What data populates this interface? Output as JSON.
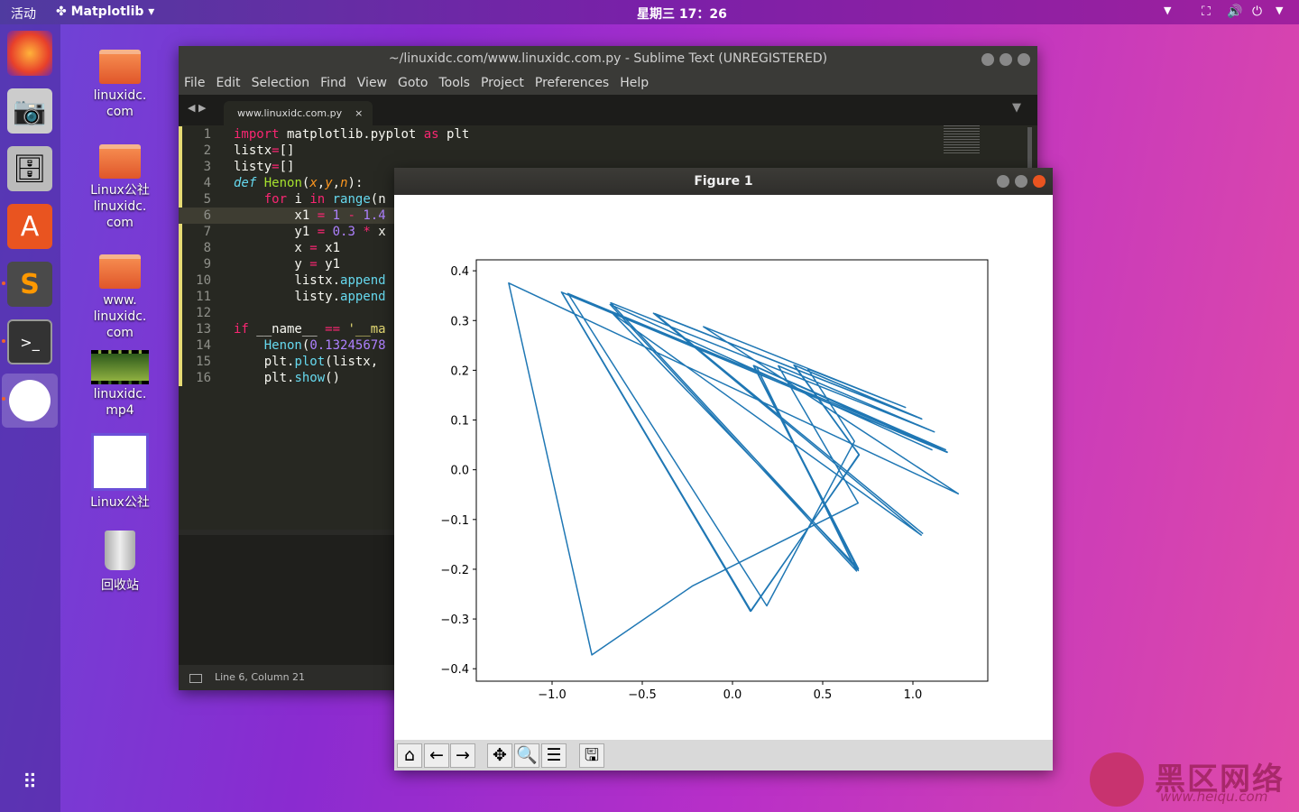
{
  "topbar": {
    "activities": "活动",
    "app_name": "Matplotlib",
    "clock": "星期三 17：26"
  },
  "dock": {
    "items": [
      "firefox",
      "camera",
      "files",
      "software-center",
      "sublime-text",
      "terminal",
      "matplotlib"
    ]
  },
  "desktop": {
    "icons": [
      {
        "label": "linuxidc.\ncom"
      },
      {
        "label": "Linux公社\nlinuxidc.\ncom"
      },
      {
        "label": "www.\nlinuxidc.\ncom"
      },
      {
        "label": "linuxidc.\nmp4"
      },
      {
        "label": "Linux公社"
      },
      {
        "label": "回收站"
      }
    ]
  },
  "sublime": {
    "title": "~/linuxidc.com/www.linuxidc.com.py - Sublime Text (UNREGISTERED)",
    "menu": [
      "File",
      "Edit",
      "Selection",
      "Find",
      "View",
      "Goto",
      "Tools",
      "Project",
      "Preferences",
      "Help"
    ],
    "tab": "www.linuxidc.com.py",
    "tab_close": "×",
    "status": "Line 6, Column 21",
    "code": [
      [
        [
          "import",
          "kw"
        ],
        [
          " matplotlib.pyplot ",
          ""
        ],
        [
          "as",
          "kw"
        ],
        [
          " plt",
          ""
        ]
      ],
      [
        [
          "listx",
          ""
        ],
        [
          "=",
          "kw"
        ],
        [
          "[]",
          ""
        ]
      ],
      [
        [
          "listy",
          ""
        ],
        [
          "=",
          "kw"
        ],
        [
          "[]",
          ""
        ]
      ],
      [
        [
          "def",
          "it2"
        ],
        [
          " ",
          ""
        ],
        [
          "Henon",
          "fn"
        ],
        [
          "(",
          ""
        ],
        [
          "x",
          "pa"
        ],
        [
          ",",
          ""
        ],
        [
          "y",
          "pa"
        ],
        [
          ",",
          ""
        ],
        [
          "n",
          "pa"
        ],
        [
          "):",
          ""
        ]
      ],
      [
        [
          "    ",
          ""
        ],
        [
          "for",
          "kw"
        ],
        [
          " i ",
          ""
        ],
        [
          "in",
          "kw"
        ],
        [
          " ",
          ""
        ],
        [
          "range",
          "bi"
        ],
        [
          "(n",
          ""
        ]
      ],
      [
        [
          "        x1 ",
          ""
        ],
        [
          "=",
          "kw"
        ],
        [
          " ",
          ""
        ],
        [
          "1",
          "num2"
        ],
        [
          " ",
          ""
        ],
        [
          "-",
          "kw"
        ],
        [
          " ",
          ""
        ],
        [
          "1.4",
          "num2"
        ]
      ],
      [
        [
          "        y1 ",
          ""
        ],
        [
          "=",
          "kw"
        ],
        [
          " ",
          ""
        ],
        [
          "0.3",
          "num2"
        ],
        [
          " ",
          ""
        ],
        [
          "*",
          "kw"
        ],
        [
          " x",
          ""
        ]
      ],
      [
        [
          "        x ",
          ""
        ],
        [
          "=",
          "kw"
        ],
        [
          " x1",
          ""
        ]
      ],
      [
        [
          "        y ",
          ""
        ],
        [
          "=",
          "kw"
        ],
        [
          " y1",
          ""
        ]
      ],
      [
        [
          "        listx.",
          ""
        ],
        [
          "append",
          "bi"
        ]
      ],
      [
        [
          "        listy.",
          ""
        ],
        [
          "append",
          "bi"
        ]
      ],
      [],
      [
        [
          "if",
          "kw"
        ],
        [
          " __name__ ",
          ""
        ],
        [
          "==",
          "kw"
        ],
        [
          " ",
          ""
        ],
        [
          "'__ma",
          "st"
        ]
      ],
      [
        [
          "    ",
          ""
        ],
        [
          "Henon",
          "bi"
        ],
        [
          "(",
          ""
        ],
        [
          "0.13245678",
          "num2"
        ]
      ],
      [
        [
          "    plt.",
          ""
        ],
        [
          "plot",
          "bi"
        ],
        [
          "(listx,",
          ""
        ]
      ],
      [
        [
          "    plt.",
          ""
        ],
        [
          "show",
          "bi"
        ],
        [
          "()",
          ""
        ]
      ]
    ]
  },
  "figure": {
    "title": "Figure 1",
    "toolbar": [
      "home",
      "back",
      "forward",
      "pan",
      "zoom",
      "configure-subplots",
      "save"
    ]
  },
  "chart_data": {
    "type": "line",
    "title": "",
    "xlabel": "",
    "ylabel": "",
    "xlim": [
      -1.42,
      1.415
    ],
    "ylim": [
      -0.425,
      0.422
    ],
    "xticks": [
      "−1.0",
      "−0.5",
      "0.0",
      "0.5",
      "1.0"
    ],
    "xtick_values": [
      -1,
      -0.5,
      0,
      0.5,
      1
    ],
    "yticks": [
      "0.4",
      "0.3",
      "0.2",
      "0.1",
      "0.0",
      "−0.1",
      "−0.2",
      "−0.3",
      "−0.4"
    ],
    "ytick_values": [
      0.4,
      0.3,
      0.2,
      0.1,
      0,
      -0.1,
      -0.2,
      -0.3,
      -0.4
    ],
    "color": "#1f77b4",
    "grid": false,
    "x": [
      1.1079,
      -0.6787,
      0.6875,
      0.1347,
      1.1809,
      -0.9119,
      0.1901,
      0.6758,
      0.4176,
      0.9585,
      -0.1609,
      1.2514,
      -1.2407,
      -0.7796,
      -0.2231,
      0.6964,
      0.2541,
      1.1185,
      -0.6752,
      0.6973,
      0.1167,
      1.1901,
      -0.9479,
      0.0991,
      0.7019,
      0.34,
      1.0488,
      -0.438,
      1.046,
      -0.6631,
      0.6982,
      0.1186,
      1.1898,
      -0.9463,
      0.1032,
      0.7012,
      0.3427,
      1.046,
      -0.4289,
      1.0562
    ],
    "y": [
      0.0397,
      0.3324,
      -0.2036,
      0.2063,
      0.0404,
      0.3543,
      -0.2736,
      0.057,
      0.2027,
      0.1253,
      0.2876,
      -0.0483,
      0.3754,
      -0.3722,
      -0.2339,
      -0.0669,
      0.2089,
      0.0762,
      0.3356,
      -0.2026,
      0.2092,
      0.035,
      0.357,
      -0.2844,
      0.0297,
      0.2106,
      0.102,
      0.3146,
      -0.1314,
      0.3138,
      -0.1989,
      0.2095,
      0.0356,
      0.3569,
      -0.2839,
      0.031,
      0.2104,
      0.1028,
      0.3138,
      -0.1287
    ]
  },
  "watermark": {
    "text": "黑区网络",
    "url": "www.heiqu.com"
  }
}
